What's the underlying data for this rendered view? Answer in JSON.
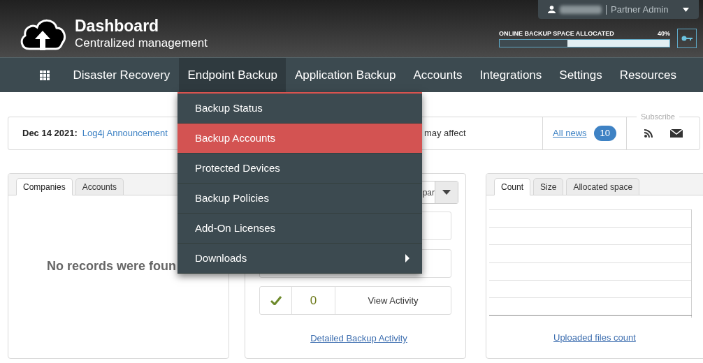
{
  "header": {
    "title": "Dashboard",
    "subtitle": "Centralized management",
    "user_menu": {
      "role": "Partner Admin"
    },
    "backup_space": {
      "label": "ONLINE BACKUP SPACE ALLOCATED",
      "reading": "40%",
      "level": 0.4
    }
  },
  "nav": [
    {
      "label": "Disaster Recovery",
      "selected": false
    },
    {
      "label": "Endpoint Backup",
      "selected": true
    },
    {
      "label": "Application Backup",
      "selected": false
    },
    {
      "label": "Accounts",
      "selected": false
    },
    {
      "label": "Integrations",
      "selected": false
    },
    {
      "label": "Settings",
      "selected": false
    },
    {
      "label": "Resources",
      "selected": false
    }
  ],
  "dropdown_menu": [
    {
      "label": "Backup Status",
      "selected": false,
      "submenu": false
    },
    {
      "label": "Backup Accounts",
      "selected": true,
      "submenu": false
    },
    {
      "label": "Protected Devices",
      "selected": false,
      "submenu": false
    },
    {
      "label": "Backup Policies",
      "selected": false,
      "submenu": false
    },
    {
      "label": "Add-On Licenses",
      "selected": false,
      "submenu": false
    },
    {
      "label": "Downloads",
      "selected": false,
      "submenu": true
    }
  ],
  "news": {
    "date": "Dec 14 2021:",
    "link": "Log4j Announcement",
    "text_tail": "may affect",
    "all_news": "All news",
    "count": "10",
    "subscribe": "Subscribe"
  },
  "companies_panel": {
    "tabs": [
      {
        "label": "Companies",
        "selected": true
      },
      {
        "label": "Accounts",
        "selected": false
      }
    ],
    "empty_message": "No records were foun"
  },
  "activity_panel": {
    "select_value": "par",
    "rows": [
      {
        "count": "0",
        "action": "View Activity"
      }
    ],
    "link": "Detailed Backup Activity"
  },
  "files_panel": {
    "tabs": [
      {
        "label": "Count",
        "selected": true
      },
      {
        "label": "Size",
        "selected": false
      },
      {
        "label": "Allocated space",
        "selected": false
      }
    ],
    "link": "Uploaded files count"
  }
}
